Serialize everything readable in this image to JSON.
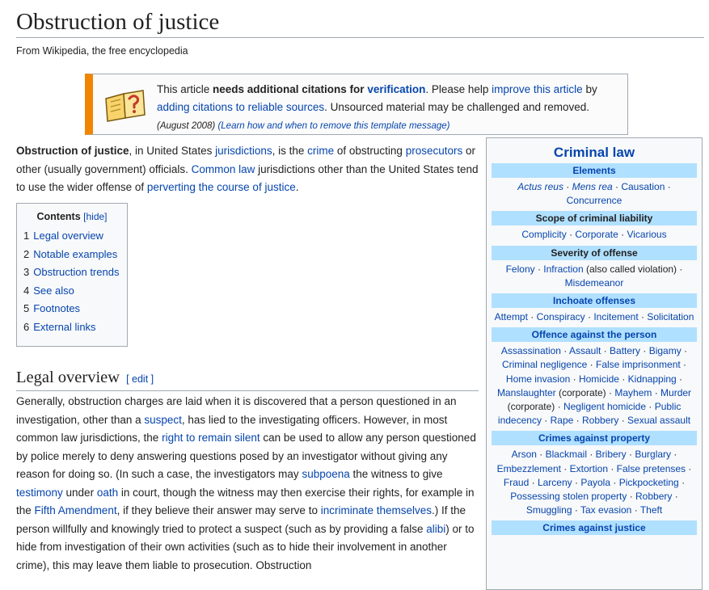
{
  "page": {
    "title": "Obstruction of justice",
    "tagline": "From Wikipedia, the free encyclopedia"
  },
  "ambox": {
    "icon": "book-question-icon",
    "text_before": "This article ",
    "bold": "needs additional citations for ",
    "bold_link": "verification",
    "text_mid": ". Please help ",
    "link1": "improve this article",
    "text_by": " by ",
    "link2": "adding citations to reliable sources",
    "text_after": ". Unsourced material may be challenged and removed.",
    "date": "(August 2008)",
    "learn_link": "(Learn how and when to remove this template message)",
    "accent_color": "#f28500"
  },
  "lead": {
    "bold": "Obstruction of justice",
    "t1": ", in United States ",
    "l1": "jurisdictions",
    "t2": ", is the ",
    "l2": "crime",
    "t3": " of obstructing ",
    "l3": "prosecutors",
    "t4": " or other (usually government) officials. ",
    "l4": "Common law",
    "t5": " jurisdictions other than the United States tend to use the wider offense of ",
    "l5": "perverting the course of justice",
    "t6": "."
  },
  "toc": {
    "title": "Contents",
    "hide": "[hide]",
    "items": [
      {
        "num": "1",
        "label": "Legal overview"
      },
      {
        "num": "2",
        "label": "Notable examples"
      },
      {
        "num": "3",
        "label": "Obstruction trends"
      },
      {
        "num": "4",
        "label": "See also"
      },
      {
        "num": "5",
        "label": "Footnotes"
      },
      {
        "num": "6",
        "label": "External links"
      }
    ]
  },
  "section": {
    "heading": "Legal overview",
    "edit": "[ edit ]",
    "p": [
      {
        "t": "Generally, obstruction charges are laid when it is discovered that a person questioned in an investigation, other than a "
      },
      {
        "l": "suspect"
      },
      {
        "t": ", has lied to the investigating officers. However, in most common law jurisdictions, the "
      },
      {
        "l": "right to remain silent"
      },
      {
        "t": " can be used to allow any person questioned by police merely to deny answering questions posed by an investigator without giving any reason for doing so. (In such a case, the investigators may "
      },
      {
        "l": "subpoena"
      },
      {
        "t": " the witness to give "
      },
      {
        "l": "testimony"
      },
      {
        "t": " under "
      },
      {
        "l": "oath"
      },
      {
        "t": " in court, though the witness may then exercise their rights, for example in the "
      },
      {
        "l": "Fifth Amendment"
      },
      {
        "t": ", if they believe their answer may serve to "
      },
      {
        "l": "incriminate themselves"
      },
      {
        "t": ".) If the person willfully and knowingly tried to protect a suspect (such as by providing a false "
      },
      {
        "l": "alibi"
      },
      {
        "t": ") or to hide from investigation of their own activities (such as to hide their involvement in another crime), this may leave them liable to prosecution. Obstruction"
      }
    ]
  },
  "sidebar": {
    "title": "Criminal law",
    "header_color": "#b0e0ff",
    "groups": [
      {
        "head": "Elements",
        "head_link": true,
        "items": [
          {
            "l": "Actus reus",
            "i": true
          },
          {
            "l": "Mens rea",
            "i": true
          },
          {
            "l": "Causation"
          },
          {
            "l": "Concurrence"
          }
        ]
      },
      {
        "head": "Scope of criminal liability",
        "head_link": false,
        "items": [
          {
            "l": "Complicity"
          },
          {
            "l": "Corporate"
          },
          {
            "l": "Vicarious"
          }
        ]
      },
      {
        "head": "Severity of offense",
        "head_link": false,
        "items": [
          {
            "l": "Felony"
          },
          {
            "l": "Infraction",
            "suffix": " (also called violation)"
          },
          {
            "l": "Misdemeanor"
          }
        ]
      },
      {
        "head": "Inchoate offenses",
        "head_link": true,
        "items": [
          {
            "l": "Attempt"
          },
          {
            "l": "Conspiracy"
          },
          {
            "l": "Incitement"
          },
          {
            "l": "Solicitation"
          }
        ]
      },
      {
        "head": "Offence against the person",
        "head_link": true,
        "items": [
          {
            "l": "Assassination"
          },
          {
            "l": "Assault"
          },
          {
            "l": "Battery"
          },
          {
            "l": "Bigamy"
          },
          {
            "l": "Criminal negligence"
          },
          {
            "l": "False imprisonment"
          },
          {
            "l": "Home invasion"
          },
          {
            "l": "Homicide"
          },
          {
            "l": "Kidnapping"
          },
          {
            "l": "Manslaughter",
            "suffix": " (corporate)"
          },
          {
            "l": "Mayhem"
          },
          {
            "l": "Murder",
            "suffix2": "(corporate)"
          },
          {
            "l": "Negligent homicide"
          },
          {
            "l": "Public indecency"
          },
          {
            "l": "Rape"
          },
          {
            "l": "Robbery"
          },
          {
            "l": "Sexual assault"
          }
        ]
      },
      {
        "head": "Crimes against property",
        "head_link": true,
        "items": [
          {
            "l": "Arson"
          },
          {
            "l": "Blackmail"
          },
          {
            "l": "Bribery"
          },
          {
            "l": "Burglary"
          },
          {
            "l": "Embezzlement"
          },
          {
            "l": "Extortion"
          },
          {
            "l": "False pretenses"
          },
          {
            "l": "Fraud"
          },
          {
            "l": "Larceny"
          },
          {
            "l": "Payola"
          },
          {
            "l": "Pickpocketing"
          },
          {
            "l": "Possessing stolen property"
          },
          {
            "l": "Robbery"
          },
          {
            "l": "Smuggling"
          },
          {
            "l": "Tax evasion"
          },
          {
            "l": "Theft"
          }
        ]
      },
      {
        "head": "Crimes against justice",
        "head_link": true,
        "items": []
      }
    ]
  }
}
